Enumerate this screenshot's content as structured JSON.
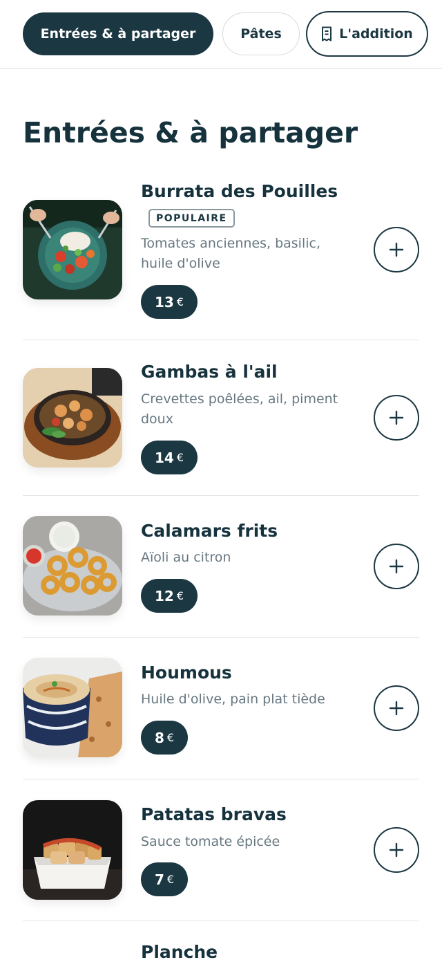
{
  "tabs": [
    {
      "label": "Entrées & à partager",
      "active": true
    },
    {
      "label": "Pâtes",
      "active": false
    }
  ],
  "bill": {
    "label": "L'addition",
    "icon": "receipt-icon"
  },
  "section": {
    "title": "Entrées & à partager"
  },
  "items": [
    {
      "name": "Burrata des Pouilles",
      "badge": "POPULAIRE",
      "description": "Tomates anciennes, basilic, huile d'olive",
      "price": "13",
      "currency": "€",
      "image": "burrata-salad-photo"
    },
    {
      "name": "Gambas à l'ail",
      "description": "Crevettes poêlées, ail, piment doux",
      "price": "14",
      "currency": "€",
      "image": "garlic-shrimp-pan-photo"
    },
    {
      "name": "Calamars frits",
      "description": "Aïoli au citron",
      "price": "12",
      "currency": "€",
      "image": "fried-calamari-photo"
    },
    {
      "name": "Houmous",
      "description": "Huile d'olive, pain plat tiède",
      "price": "8",
      "currency": "€",
      "image": "hummus-bowl-photo"
    },
    {
      "name": "Patatas bravas",
      "description": "Sauce tomate épicée",
      "price": "7",
      "currency": "€",
      "image": "patatas-bravas-photo"
    },
    {
      "name": "Planche"
    }
  ],
  "colors": {
    "primary": "#1b3742",
    "text": "#16323d",
    "muted": "#667780",
    "divider": "#e3e6e8"
  }
}
